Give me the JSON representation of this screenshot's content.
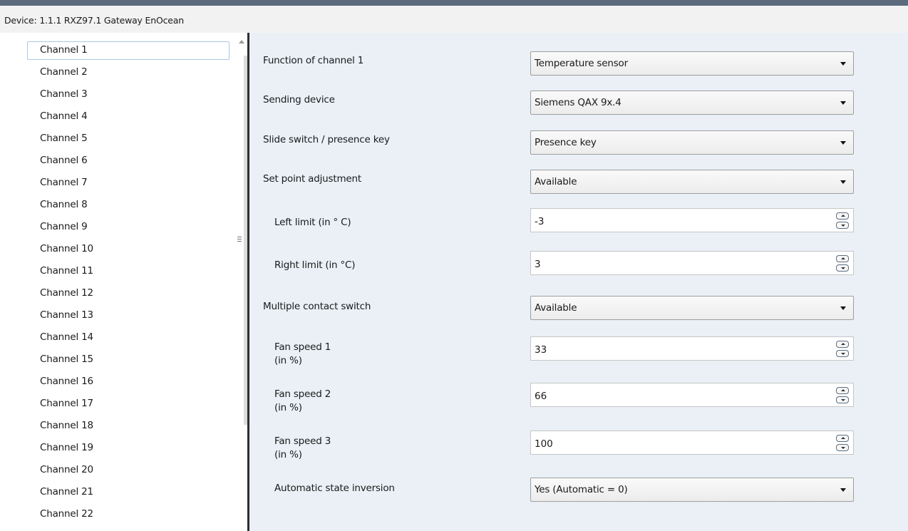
{
  "device_title": "Device: 1.1.1  RXZ97.1 Gateway EnOcean",
  "channels": [
    "Channel 1",
    "Channel 2",
    "Channel 3",
    "Channel 4",
    "Channel 5",
    "Channel 6",
    "Channel 7",
    "Channel 8",
    "Channel 9",
    "Channel 10",
    "Channel 11",
    "Channel 12",
    "Channel 13",
    "Channel 14",
    "Channel 15",
    "Channel 16",
    "Channel 17",
    "Channel 18",
    "Channel 19",
    "Channel 20",
    "Channel 21",
    "Channel 22"
  ],
  "selected_channel": "Channel 1",
  "params": {
    "function": {
      "label": "Function of channel 1",
      "value": "Temperature sensor"
    },
    "sending_device": {
      "label": "Sending device",
      "value": "Siemens QAX 9x.4"
    },
    "slide_switch": {
      "label": "Slide switch / presence key",
      "value": "Presence key"
    },
    "set_point": {
      "label": "Set point adjustment",
      "value": "Available"
    },
    "left_limit": {
      "label": "Left limit   (in ° C)",
      "value": "-3"
    },
    "right_limit": {
      "label": "Right limit   (in °C)",
      "value": "3"
    },
    "multi_contact": {
      "label": "Multiple contact switch",
      "value": "Available"
    },
    "fan1": {
      "label_line1": "Fan speed 1",
      "label_line2": "(in %)",
      "value": "33"
    },
    "fan2": {
      "label_line1": "Fan speed 2",
      "label_line2": "(in %)",
      "value": "66"
    },
    "fan3": {
      "label_line1": "Fan speed 3",
      "label_line2": "(in %)",
      "value": "100"
    },
    "auto_inversion": {
      "label": "Automatic state inversion",
      "value": "Yes (Automatic = 0)"
    }
  },
  "colors": {
    "panel_bg": "#eaf0f6",
    "selection_border": "#a9c8e8",
    "divider": "#2e2e2e"
  }
}
